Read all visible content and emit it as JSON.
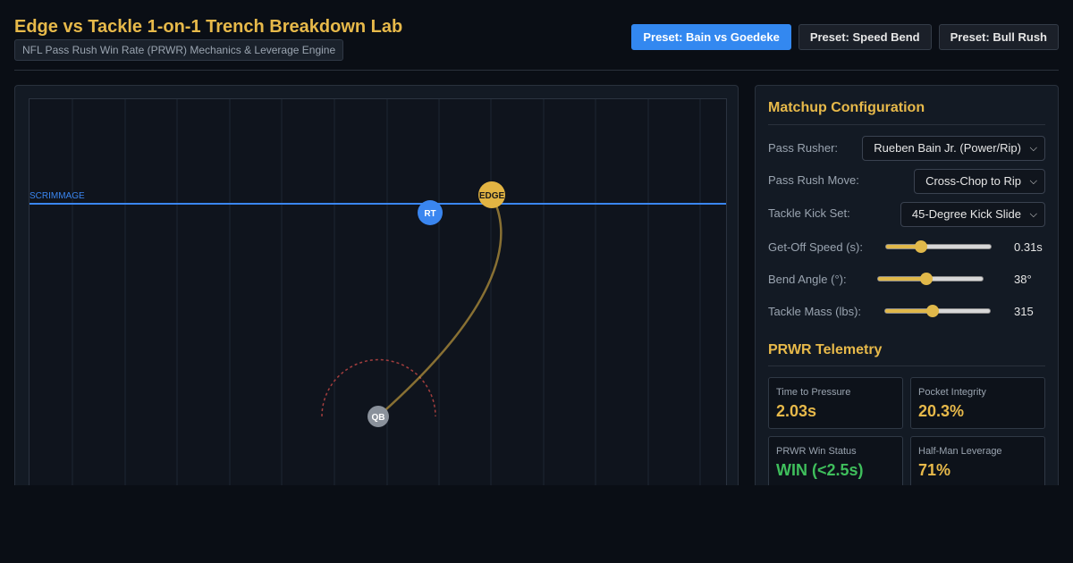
{
  "header": {
    "title": "Edge vs Tackle 1-on-1 Trench Breakdown Lab",
    "subtitle": "NFL Pass Rush Win Rate (PRWR) Mechanics & Leverage Engine"
  },
  "presets": [
    {
      "label": "Preset: Bain vs Goedeke",
      "active": true
    },
    {
      "label": "Preset: Speed Bend",
      "active": false
    },
    {
      "label": "Preset: Bull Rush",
      "active": false
    }
  ],
  "field": {
    "scrimmage_label": "SCRIMMAGE",
    "players": {
      "rt": "RT",
      "edge": "EDGE",
      "qb": "QB"
    },
    "colors": {
      "scrimmage": "#3a86f0",
      "rt": "#3a86f0",
      "edge": "#e2b443",
      "qb": "#8a919b",
      "path": "#c9a13f",
      "pocket": "#b0413f"
    }
  },
  "config": {
    "title": "Matchup Configuration",
    "rusher": {
      "label": "Pass Rusher:",
      "value": "Rueben Bain Jr. (Power/Rip)"
    },
    "move": {
      "label": "Pass Rush Move:",
      "value": "Cross-Chop to Rip"
    },
    "kick": {
      "label": "Tackle Kick Set:",
      "value": "45-Degree Kick Slide"
    },
    "get_off": {
      "label": "Get-Off Speed (s):",
      "display": "0.31s",
      "level": 0.33
    },
    "bend": {
      "label": "Bend Angle (°):",
      "display": "38°",
      "level": 0.46
    },
    "mass": {
      "label": "Tackle Mass (lbs):",
      "display": "315",
      "level": 0.45
    }
  },
  "telemetry": {
    "title": "PRWR Telemetry",
    "cards": {
      "ttp": {
        "label": "Time to Pressure",
        "value": "2.03s"
      },
      "pocket": {
        "label": "Pocket Integrity",
        "value": "20.3%"
      },
      "status": {
        "label": "PRWR Win Status",
        "value": "WIN (<2.5s)"
      },
      "leverage": {
        "label": "Half-Man Leverage",
        "value": "71%"
      }
    }
  }
}
